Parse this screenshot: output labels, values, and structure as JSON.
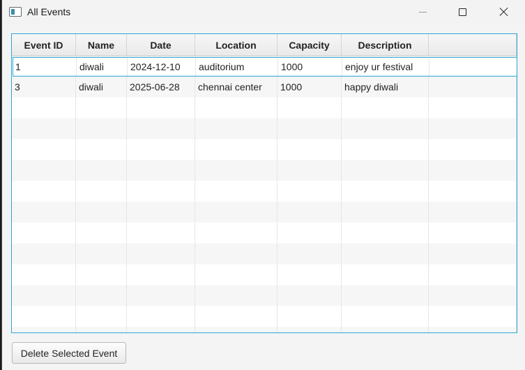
{
  "window": {
    "title": "All Events",
    "controls": [
      "minimize-icon",
      "maximize-icon",
      "close-icon"
    ]
  },
  "table": {
    "columns": [
      "Event ID",
      "Name",
      "Date",
      "Location",
      "Capacity",
      "Description",
      ""
    ],
    "rows": [
      [
        "1",
        "diwali",
        "2024-12-10",
        "auditorium",
        "1000",
        "enjoy ur festival",
        ""
      ],
      [
        "3",
        "diwali",
        "2025-06-28",
        "chennai center",
        "1000",
        "happy diwali",
        ""
      ]
    ],
    "selected_row": 0,
    "accent_color": "#2aa6d6"
  },
  "actions": {
    "delete_label": "Delete Selected Event"
  }
}
